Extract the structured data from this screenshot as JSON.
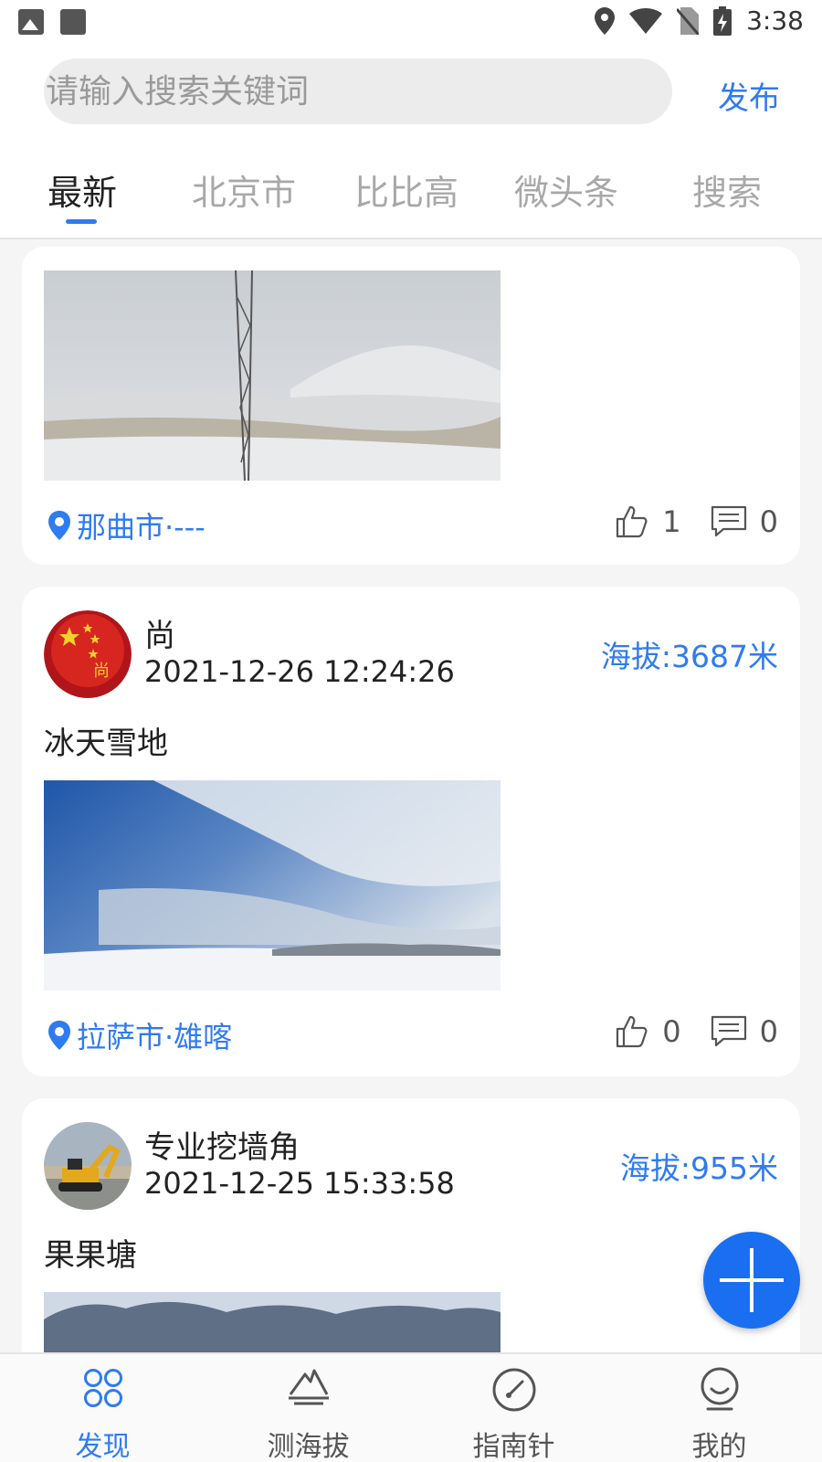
{
  "status_bar": {
    "time": "3:38"
  },
  "header": {
    "search_placeholder": "请输入搜索关键词",
    "publish_label": "发布",
    "tabs": [
      {
        "label": "最新",
        "active": true
      },
      {
        "label": "北京市",
        "active": false
      },
      {
        "label": "比比高",
        "active": false
      },
      {
        "label": "微头条",
        "active": false
      },
      {
        "label": "搜索",
        "active": false
      }
    ]
  },
  "posts": [
    {
      "location": "那曲市·---",
      "likes": "1",
      "comments": "0"
    },
    {
      "user": "尚",
      "time": "2021-12-26 12:24:26",
      "altitude": "海拔:3687米",
      "text": "冰天雪地",
      "location": "拉萨市·雄喀",
      "likes": "0",
      "comments": "0"
    },
    {
      "user": "专业挖墙角",
      "time": "2021-12-25 15:33:58",
      "altitude": "海拔:955米",
      "text": "果果塘"
    }
  ],
  "bottom_nav": [
    {
      "label": "发现",
      "icon": "discover-icon",
      "active": true
    },
    {
      "label": "测海拔",
      "icon": "mountain-icon",
      "active": false
    },
    {
      "label": "指南针",
      "icon": "compass-icon",
      "active": false
    },
    {
      "label": "我的",
      "icon": "profile-icon",
      "active": false
    }
  ],
  "colors": {
    "accent": "#2f7bf0",
    "fab": "#1a6ff0"
  }
}
